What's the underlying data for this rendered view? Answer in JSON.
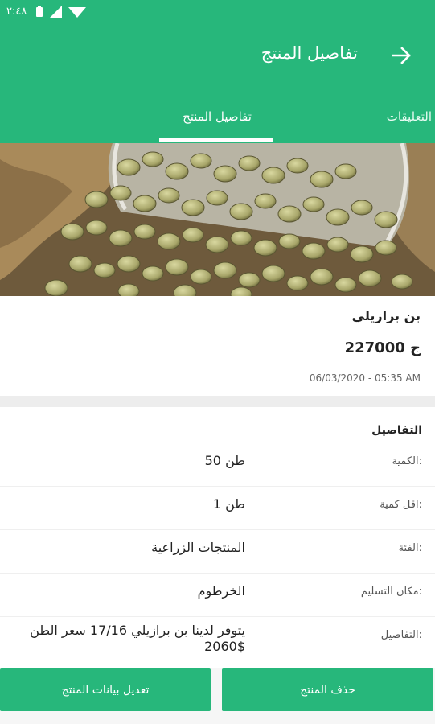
{
  "status_bar": {
    "time": "٢:٤٨",
    "icons": [
      "wifi-icon",
      "signal-icon",
      "battery-icon"
    ]
  },
  "toolbar": {
    "title": "تفاصيل المنتج",
    "back_icon": "arrow-right-icon"
  },
  "tabs": [
    {
      "label": "تفاصيل المنتج",
      "active": true
    },
    {
      "label": "التعليقات",
      "active": false
    }
  ],
  "product": {
    "name": "بن برازيلي",
    "price": "227000 ج",
    "date": "06/03/2020 - 05:35 AM"
  },
  "details": {
    "section_title": "التفاصيل",
    "rows": [
      {
        "label": "الكمية:",
        "value": "50 طن"
      },
      {
        "label": "اقل كمية:",
        "value": "1 طن"
      },
      {
        "label": "الفئة:",
        "value": "المنتجات الزراعية"
      },
      {
        "label": "مكان التسليم:",
        "value": "الخرطوم"
      },
      {
        "label": "التفاصيل:",
        "value": "يتوفر لدينا بن برازيلي 17/16 سعر الطن 2060$"
      }
    ]
  },
  "actions": {
    "delete_label": "حذف المنتج",
    "edit_label": "تعديل بيانات المنتج"
  },
  "colors": {
    "primary": "#27b77b",
    "background": "#ffffff"
  }
}
